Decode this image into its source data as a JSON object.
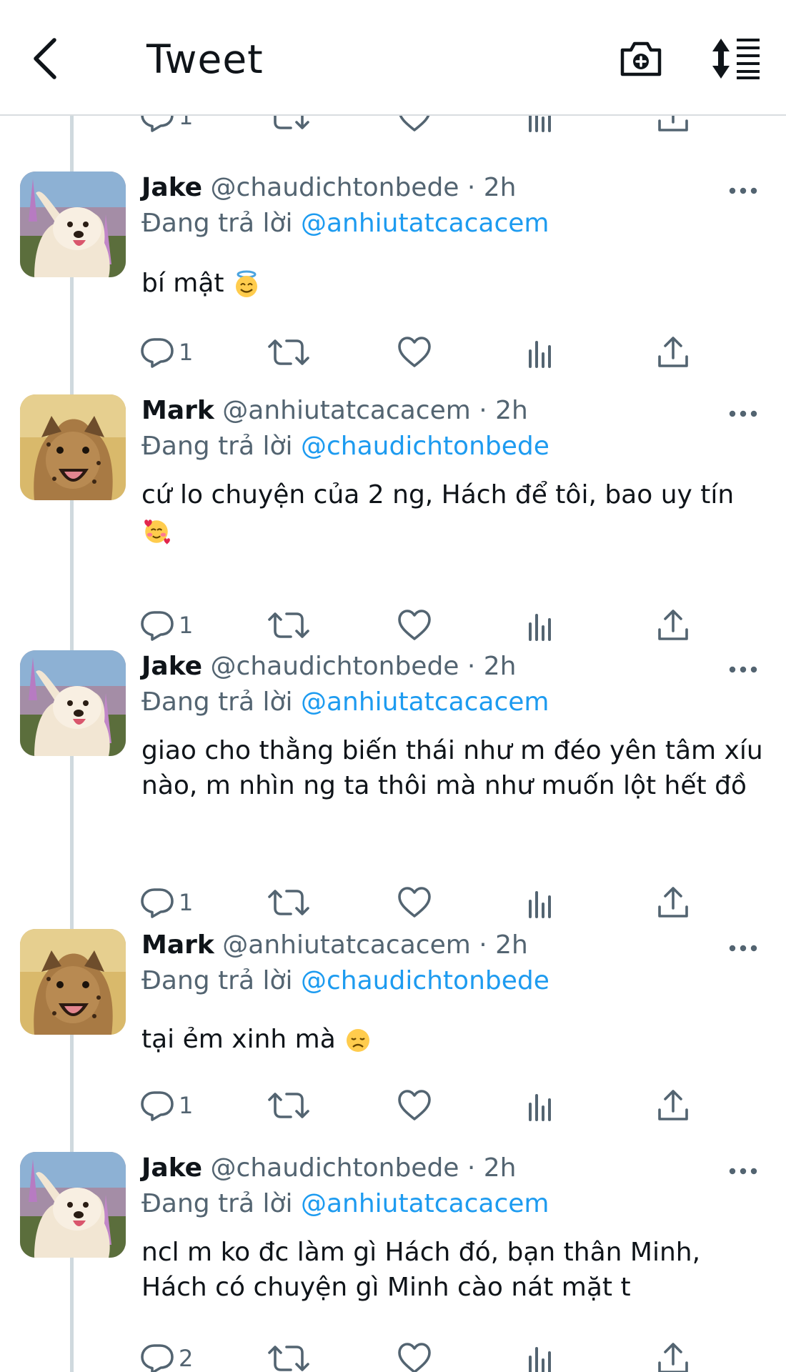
{
  "header": {
    "title": "Tweet"
  },
  "top_partial_actions": {
    "reply_count": "1"
  },
  "reply_prefix": "Đang trả lời",
  "tweets": [
    {
      "name": "Jake",
      "handle": "@chaudichtonbede · 2h",
      "reply_to": "@anhiutatcacacem",
      "text": "bí mật",
      "emoji": "halo",
      "reply_count": "1",
      "avatar": "samoyed-dog"
    },
    {
      "name": "Mark",
      "handle": "@anhiutatcacacem · 2h",
      "reply_to": "@chaudichtonbede",
      "text": "cứ lo chuyện của 2 ng, Hách để tôi, bao uy tín",
      "emoji": "hearts-face",
      "reply_count": "1",
      "avatar": "cheetah-cub"
    },
    {
      "name": "Jake",
      "handle": "@chaudichtonbede · 2h",
      "reply_to": "@anhiutatcacacem",
      "text": "giao cho thằng biến thái như m đéo yên tâm xíu nào, m nhìn ng ta thôi mà như muốn lột hết đồ",
      "reply_count": "1",
      "avatar": "samoyed-dog"
    },
    {
      "name": "Mark",
      "handle": "@anhiutatcacacem · 2h",
      "reply_to": "@chaudichtonbede",
      "text": "tại ẻm xinh mà",
      "emoji": "disappointed",
      "reply_count": "1",
      "avatar": "cheetah-cub"
    },
    {
      "name": "Jake",
      "handle": "@chaudichtonbede · 2h",
      "reply_to": "@anhiutatcacacem",
      "text": "ncl m ko đc làm gì Hách đó, bạn thân Minh, Hách có chuyện gì Minh cào nát mặt t",
      "reply_count": "2",
      "avatar": "samoyed-dog"
    }
  ],
  "colors": {
    "link": "#1d9bf0",
    "secondary_text": "#536471",
    "thread_line": "#cfd9de"
  }
}
